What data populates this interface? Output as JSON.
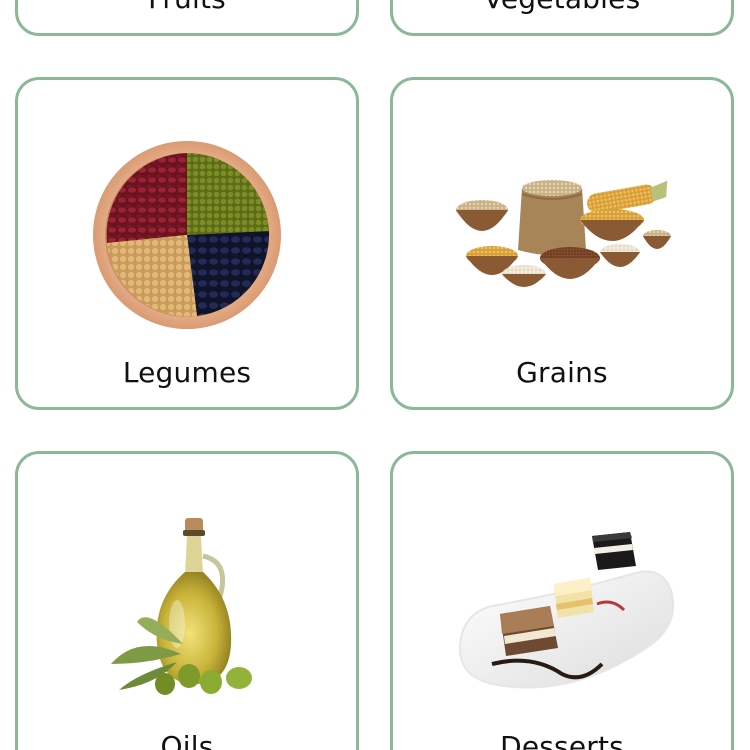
{
  "categories": [
    {
      "label": "Fruits"
    },
    {
      "label": "Vegetables"
    },
    {
      "label": "Legumes"
    },
    {
      "label": "Grains"
    },
    {
      "label": "Oils"
    },
    {
      "label": "Desserts"
    }
  ],
  "colors": {
    "card_border": "#8bb898",
    "label_text": "#111111",
    "background": "#ffffff"
  },
  "icons": {
    "legumes": "legumes-bowl-image",
    "grains": "grains-sack-image",
    "oils": "olive-oil-bottle-image",
    "desserts": "dessert-plate-image"
  }
}
